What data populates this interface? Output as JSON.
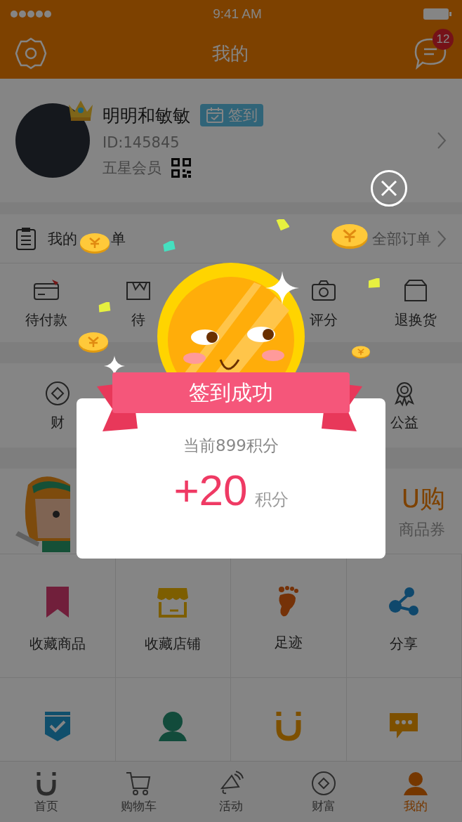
{
  "status_bar": {
    "time": "9:41 AM"
  },
  "nav": {
    "title": "我的",
    "message_badge": "12"
  },
  "profile": {
    "name": "明明和敏敏",
    "checkin_label": "签到",
    "id": "ID:145845",
    "member_level": "五星会员"
  },
  "orders": {
    "title_start": "我的",
    "title_end": "单",
    "all_link": "全部订单",
    "items": [
      {
        "kind": "payment",
        "label": "待付款"
      },
      {
        "kind": "shipping",
        "label": "待"
      },
      {
        "kind": "review",
        "label": "评分"
      },
      {
        "kind": "return",
        "label": "退换货"
      }
    ]
  },
  "services": [
    {
      "kind": "wealth",
      "label": "财"
    },
    {
      "kind": "charity",
      "label": "公益"
    }
  ],
  "promo": {
    "title": "U购",
    "subtitle": "商品券"
  },
  "grid": [
    {
      "kind": "bookmark",
      "label": "收藏商品"
    },
    {
      "kind": "store",
      "label": "收藏店铺"
    },
    {
      "kind": "footprint",
      "label": "足迹"
    },
    {
      "kind": "share",
      "label": "分享"
    },
    {
      "kind": "shield"
    },
    {
      "kind": "person"
    },
    {
      "kind": "magnet"
    },
    {
      "kind": "chat"
    }
  ],
  "tabs": [
    {
      "kind": "home",
      "label": "首页",
      "selected": false
    },
    {
      "kind": "cart",
      "label": "购物车",
      "selected": false
    },
    {
      "kind": "activity",
      "label": "活动",
      "selected": false
    },
    {
      "kind": "wealth",
      "label": "财富",
      "selected": false
    },
    {
      "kind": "me",
      "label": "我的",
      "selected": true
    }
  ],
  "popup": {
    "banner": "签到成功",
    "current_points": "当前899积分",
    "gain": "+20",
    "unit": "积分"
  }
}
